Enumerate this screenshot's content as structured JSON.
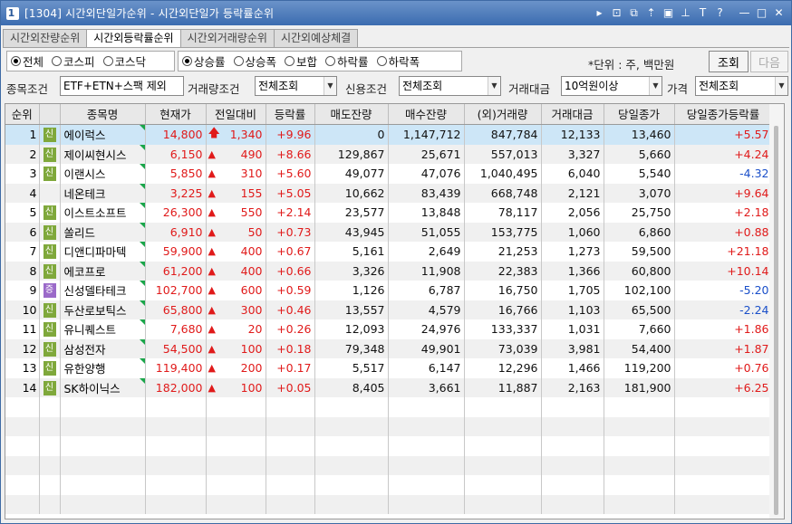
{
  "window": {
    "number": "1",
    "title": "[1304] 시간외단일가순위 - 시간외단일가 등락률순위",
    "controls": [
      "▸",
      "⊡",
      "⧉",
      "⇡",
      "▣",
      "⊥",
      "T",
      "?",
      "—",
      "□",
      "✕"
    ]
  },
  "tabs": [
    "시간외잔량순위",
    "시간외등락률순위",
    "시간외거래량순위",
    "시간외예상체결"
  ],
  "active_tab": 1,
  "market_radios": [
    {
      "label": "전체",
      "checked": true
    },
    {
      "label": "코스피",
      "checked": false
    },
    {
      "label": "코스닥",
      "checked": false
    }
  ],
  "sort_radios": [
    {
      "label": "상승률",
      "checked": true
    },
    {
      "label": "상승폭",
      "checked": false
    },
    {
      "label": "보합",
      "checked": false
    },
    {
      "label": "하락률",
      "checked": false
    },
    {
      "label": "하락폭",
      "checked": false
    }
  ],
  "unit_text": "*단위 : 주, 백만원",
  "buttons": {
    "search": "조회",
    "next": "다음"
  },
  "conditions": {
    "stock_label": "종목조건",
    "stock_value": "ETF+ETN+스팩 제외",
    "volume_label": "거래량조건",
    "volume_value": "전체조회",
    "credit_label": "신용조건",
    "credit_value": "전체조회",
    "amount_label": "거래대금",
    "amount_value": "10억원이상",
    "price_label": "가격",
    "price_value": "전체조회"
  },
  "table": {
    "headers": [
      "순위",
      "",
      "종목명",
      "현재가",
      "전일대비",
      "등락률",
      "매도잔량",
      "매수잔량",
      "(외)거래량",
      "거래대금",
      "당일종가",
      "당일종가등락률"
    ],
    "rows": [
      {
        "rank": "1",
        "badge": "신",
        "name": "에이럭스",
        "price": "14,800",
        "arrow": "up-bold",
        "change": "1,340",
        "rate": "+9.96",
        "ask": "0",
        "bid": "1,147,712",
        "volume": "847,784",
        "amount": "12,133",
        "close": "13,460",
        "close_rate": "+5.57",
        "close_color": "red",
        "selected": true
      },
      {
        "rank": "2",
        "badge": "신",
        "name": "제이씨현시스",
        "price": "6,150",
        "arrow": "up",
        "change": "490",
        "rate": "+8.66",
        "ask": "129,867",
        "bid": "25,671",
        "volume": "557,013",
        "amount": "3,327",
        "close": "5,660",
        "close_rate": "+4.24",
        "close_color": "red"
      },
      {
        "rank": "3",
        "badge": "신",
        "name": "이랜시스",
        "price": "5,850",
        "arrow": "up",
        "change": "310",
        "rate": "+5.60",
        "ask": "49,077",
        "bid": "47,076",
        "volume": "1,040,495",
        "amount": "6,040",
        "close": "5,540",
        "close_rate": "-4.32",
        "close_color": "blue"
      },
      {
        "rank": "4",
        "badge": "",
        "name": "네온테크",
        "price": "3,225",
        "arrow": "up",
        "change": "155",
        "rate": "+5.05",
        "ask": "10,662",
        "bid": "83,439",
        "volume": "668,748",
        "amount": "2,121",
        "close": "3,070",
        "close_rate": "+9.64",
        "close_color": "red"
      },
      {
        "rank": "5",
        "badge": "신",
        "name": "이스트소프트",
        "price": "26,300",
        "arrow": "up",
        "change": "550",
        "rate": "+2.14",
        "ask": "23,577",
        "bid": "13,848",
        "volume": "78,117",
        "amount": "2,056",
        "close": "25,750",
        "close_rate": "+2.18",
        "close_color": "red"
      },
      {
        "rank": "6",
        "badge": "신",
        "name": "쏠리드",
        "price": "6,910",
        "arrow": "up",
        "change": "50",
        "rate": "+0.73",
        "ask": "43,945",
        "bid": "51,055",
        "volume": "153,775",
        "amount": "1,060",
        "close": "6,860",
        "close_rate": "+0.88",
        "close_color": "red"
      },
      {
        "rank": "7",
        "badge": "신",
        "name": "디앤디파마텍",
        "price": "59,900",
        "arrow": "up",
        "change": "400",
        "rate": "+0.67",
        "ask": "5,161",
        "bid": "2,649",
        "volume": "21,253",
        "amount": "1,273",
        "close": "59,500",
        "close_rate": "+21.18",
        "close_color": "red"
      },
      {
        "rank": "8",
        "badge": "신",
        "name": "에코프로",
        "price": "61,200",
        "arrow": "up",
        "change": "400",
        "rate": "+0.66",
        "ask": "3,326",
        "bid": "11,908",
        "volume": "22,383",
        "amount": "1,366",
        "close": "60,800",
        "close_rate": "+10.14",
        "close_color": "red"
      },
      {
        "rank": "9",
        "badge": "증",
        "name": "신성델타테크",
        "price": "102,700",
        "arrow": "up",
        "change": "600",
        "rate": "+0.59",
        "ask": "1,126",
        "bid": "6,787",
        "volume": "16,750",
        "amount": "1,705",
        "close": "102,100",
        "close_rate": "-5.20",
        "close_color": "blue"
      },
      {
        "rank": "10",
        "badge": "신",
        "name": "두산로보틱스",
        "price": "65,800",
        "arrow": "up",
        "change": "300",
        "rate": "+0.46",
        "ask": "13,557",
        "bid": "4,579",
        "volume": "16,766",
        "amount": "1,103",
        "close": "65,500",
        "close_rate": "-2.24",
        "close_color": "blue"
      },
      {
        "rank": "11",
        "badge": "신",
        "name": "유니퀘스트",
        "price": "7,680",
        "arrow": "up",
        "change": "20",
        "rate": "+0.26",
        "ask": "12,093",
        "bid": "24,976",
        "volume": "133,337",
        "amount": "1,031",
        "close": "7,660",
        "close_rate": "+1.86",
        "close_color": "red"
      },
      {
        "rank": "12",
        "badge": "신",
        "name": "삼성전자",
        "price": "54,500",
        "arrow": "up",
        "change": "100",
        "rate": "+0.18",
        "ask": "79,348",
        "bid": "49,901",
        "volume": "73,039",
        "amount": "3,981",
        "close": "54,400",
        "close_rate": "+1.87",
        "close_color": "red"
      },
      {
        "rank": "13",
        "badge": "신",
        "name": "유한양행",
        "price": "119,400",
        "arrow": "up",
        "change": "200",
        "rate": "+0.17",
        "ask": "5,517",
        "bid": "6,147",
        "volume": "12,296",
        "amount": "1,466",
        "close": "119,200",
        "close_rate": "+0.76",
        "close_color": "red"
      },
      {
        "rank": "14",
        "badge": "신",
        "name": "SK하이닉스",
        "price": "182,000",
        "arrow": "up",
        "change": "100",
        "rate": "+0.05",
        "ask": "8,405",
        "bid": "3,661",
        "volume": "11,887",
        "amount": "2,163",
        "close": "181,900",
        "close_rate": "+6.25",
        "close_color": "red"
      }
    ]
  },
  "colors": {
    "up": "#e01a1a",
    "down": "#1a4fc9",
    "selected_row": "#cde6f7",
    "badge_new": "#7fa83b",
    "badge_increase": "#9b6ac9",
    "title_bar": "#3b6cb0"
  }
}
